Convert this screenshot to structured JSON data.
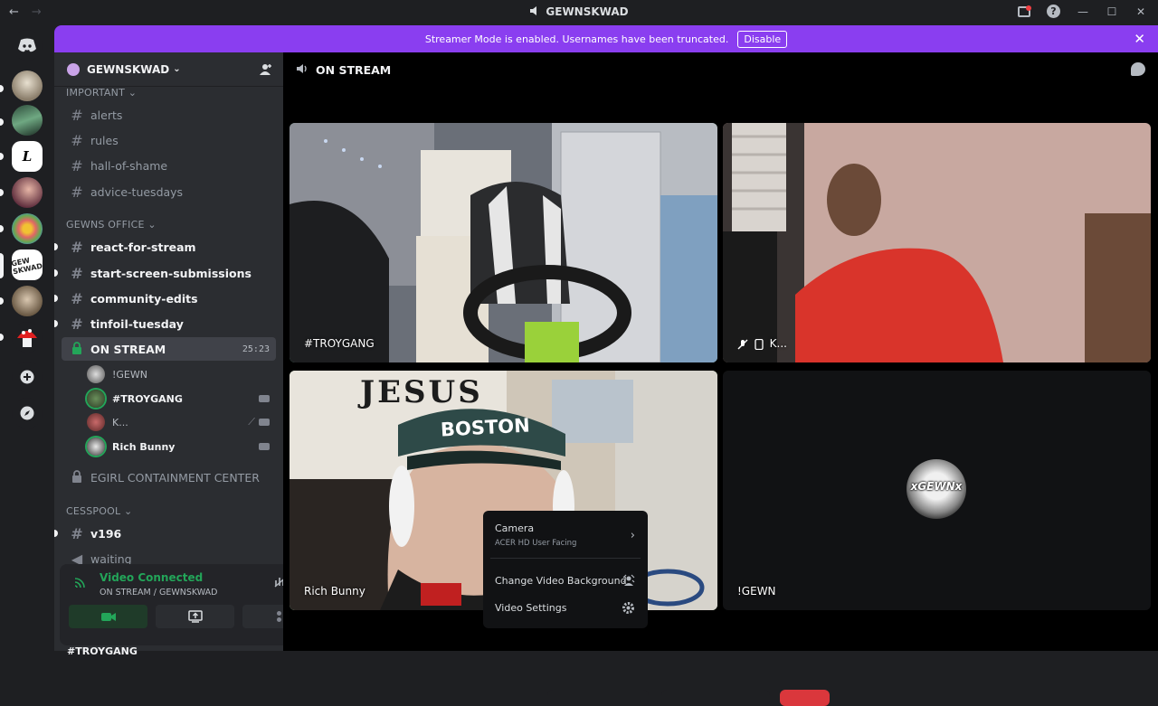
{
  "window": {
    "title": "GEWNSKWAD",
    "back": "←",
    "forward": "→",
    "minimize": "—",
    "maximize": "☐",
    "close": "✕"
  },
  "banner": {
    "text": "Streamer Mode is enabled. Usernames have been truncated.",
    "button": "Disable",
    "close": "✕"
  },
  "server": {
    "name": "GEWNSKWAD"
  },
  "categories": {
    "important": "IMPORTANT",
    "gewns_office": "GEWNS OFFICE",
    "cesspool": "CESSPOOL"
  },
  "channels": {
    "alerts": "alerts",
    "rules": "rules",
    "hall_of_shame": "hall-of-shame",
    "advice_tuesdays": "advice-tuesdays",
    "react_for_stream": "react-for-stream",
    "start_screen_submissions": "start-screen-submissions",
    "community_edits": "community-edits",
    "tinfoil_tuesday": "tinfoil-tuesday",
    "on_stream": "ON STREAM",
    "on_stream_time": "25:23",
    "egirl": "EGIRL CONTAINMENT CENTER",
    "v196": "v196",
    "waiting": "waiting"
  },
  "voice_users": [
    "!GEWN",
    "#TROYGANG",
    "K...",
    "Rich Bunny"
  ],
  "voice_panel": {
    "status": "Video Connected",
    "location": "ON STREAM / GEWNSKWAD",
    "bottom_user": "#TROYGANG"
  },
  "main": {
    "channel": "ON STREAM"
  },
  "tiles": {
    "troygang": "#TROYGANG",
    "k": "K...",
    "rich_bunny": "Rich Bunny",
    "gewn": "!GEWN",
    "avatar_text": "xGEWNx"
  },
  "context_menu": {
    "camera": "Camera",
    "camera_device": "ACER HD User Facing",
    "change_bg": "Change Video Background",
    "video_settings": "Video Settings"
  },
  "colors": {
    "banner": "#8a3ef0",
    "speaking": "#23a559",
    "sidebar": "#2b2d31",
    "rail": "#1e1f22"
  }
}
